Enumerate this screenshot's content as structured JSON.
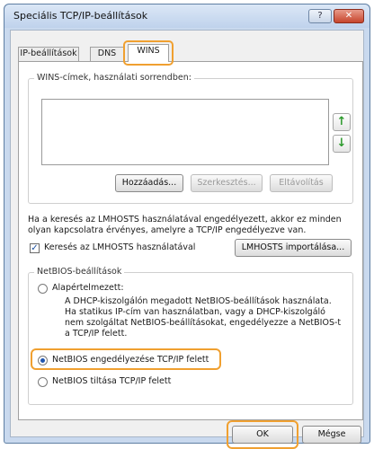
{
  "window": {
    "title": "Speciális TCP/IP-beállítások",
    "help_label": "?",
    "close_label": "✕"
  },
  "tabs": [
    {
      "label": "IP-beállítások"
    },
    {
      "label": "DNS"
    },
    {
      "label": "WINS"
    }
  ],
  "wins_group": {
    "label": "WINS-címek, használati sorrendben:",
    "add_label": "Hozzáadás...",
    "edit_label": "Szerkesztés...",
    "remove_label": "Eltávolítás",
    "up_icon": "up-arrow-icon",
    "down_icon": "down-arrow-icon"
  },
  "lmhosts": {
    "info": "Ha a keresés az LMHOSTS használatával engedélyezett, akkor ez minden olyan kapcsolatra érvényes, amelyre a TCP/IP engedélyezve van.",
    "checkbox_label": "Keresés az LMHOSTS használatával",
    "checked": true,
    "import_label": "LMHOSTS importálása..."
  },
  "netbios": {
    "label": "NetBIOS-beállítások",
    "options": [
      {
        "label": "Alapértelmezett:"
      },
      {
        "label": "NetBIOS engedélyezése TCP/IP felett"
      },
      {
        "label": "NetBIOS tiltása TCP/IP felett"
      }
    ],
    "selected_index": 1,
    "default_description": "A DHCP-kiszolgálón megadott NetBIOS-beállítások használata. Ha statikus IP-cím van használatban, vagy a DHCP-kiszolgáló nem szolgáltat NetBIOS-beállításokat, engedélyezze a NetBIOS-t a TCP/IP felett."
  },
  "footer": {
    "ok_label": "OK",
    "cancel_label": "Mégse"
  },
  "colors": {
    "highlight": "#f0a030",
    "title_bg": "#c9d9ee",
    "close_bg": "#c6452c"
  }
}
